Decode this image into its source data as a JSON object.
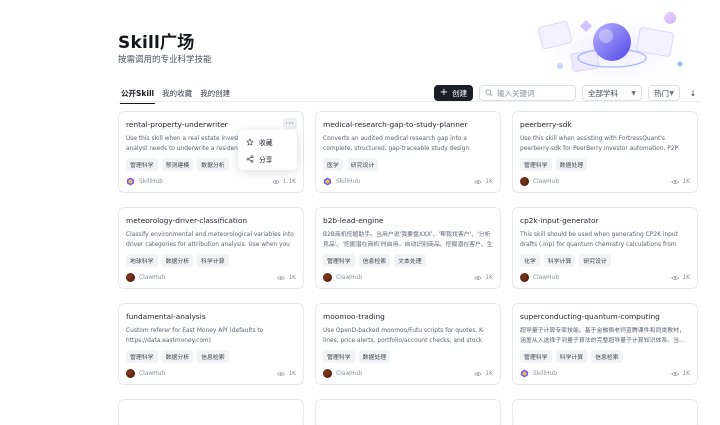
{
  "page": {
    "title": "Skill广场",
    "subtitle": "按需调用的专业科学技能"
  },
  "tabs": [
    {
      "label": "公开Skill",
      "active": true
    },
    {
      "label": "我的收藏",
      "active": false
    },
    {
      "label": "我的创建",
      "active": false
    }
  ],
  "toolbar": {
    "create_label": "创建",
    "search_placeholder": "输入关键词",
    "category_value": "全部学科",
    "sort_value": "热门"
  },
  "context_menu": {
    "favorite_label": "收藏",
    "share_label": "分享"
  },
  "cards": [
    {
      "name": "rental-property-underwriter",
      "desc": "Use this skill when a real estate investor, agent, or analyst needs to underwrite a residential rental property —",
      "tags": [
        "管理科学",
        "预测建模",
        "数据分析"
      ],
      "source": "SkillHub",
      "views": "1.1K"
    },
    {
      "name": "medical-research-gap-to-study-planner",
      "desc": "Converts an audited medical research gap into a complete, structured, gap-traceable study design. Always use this skill...",
      "tags": [
        "医学",
        "研究设计"
      ],
      "source": "SkillHub",
      "views": "1K"
    },
    {
      "name": "peerberry-sdk",
      "desc": "Use this skill when assisting with FortressQuant's peerberry-sdk for PeerBerry investor automation, P2P lending education, and...",
      "tags": [
        "管理科学",
        "数据处理"
      ],
      "source": "ClawHub",
      "views": "1K"
    },
    {
      "name": "meteorology-driver-classification",
      "desc": "Classify environmental and meteorological variables into driver categories for attribution analysis. Use when you need to group...",
      "tags": [
        "地球科学",
        "数据分析",
        "科学计算"
      ],
      "source": "ClawHub",
      "views": "1K"
    },
    {
      "name": "b2b-lead-engine",
      "desc": "B2B商机挖掘助手。当用户说'我要盘XXX'、'帮我找客户'、'分析竞品'、'挖掘潜在商机'时启用。自动识别商品、挖掘潜在客户、生成个...",
      "tags": [
        "管理科学",
        "信息检索",
        "文本处理"
      ],
      "source": "ClawHub",
      "views": "1K"
    },
    {
      "name": "cp2k-input-generator",
      "desc": "This skill should be used when generating CP2K input drafts (.inp) for quantum chemistry calculations from local structure...",
      "tags": [
        "化学",
        "科学计算",
        "研究设计"
      ],
      "source": "ClawHub",
      "views": "1K"
    },
    {
      "name": "fundamental-analysis",
      "desc": "Custom referer for East Money API (defaults to https://data.eastmoney.com)",
      "tags": [
        "管理科学",
        "数据分析",
        "信息检索"
      ],
      "source": "ClawHub",
      "views": "1K"
    },
    {
      "name": "moomoo-trading",
      "desc": "Use OpenD-backed moomoo/Futu scripts for quotes, K-lines, price alerts, portfolio/account checks, and stock order executio...",
      "tags": [
        "管理科学",
        "数据处理"
      ],
      "source": "ClawHub",
      "views": "1K"
    },
    {
      "name": "superconducting-quantum-computing",
      "desc": "超导量子计算专家技能。基于金融佩老师蓝腾课件和同类教材，涵盖从入选择子到量子算法的完整超导量子计算知识体系。当...",
      "tags": [
        "管理科学",
        "科学计算",
        "信息检索"
      ],
      "source": "SkillHub",
      "views": "1K"
    }
  ]
}
